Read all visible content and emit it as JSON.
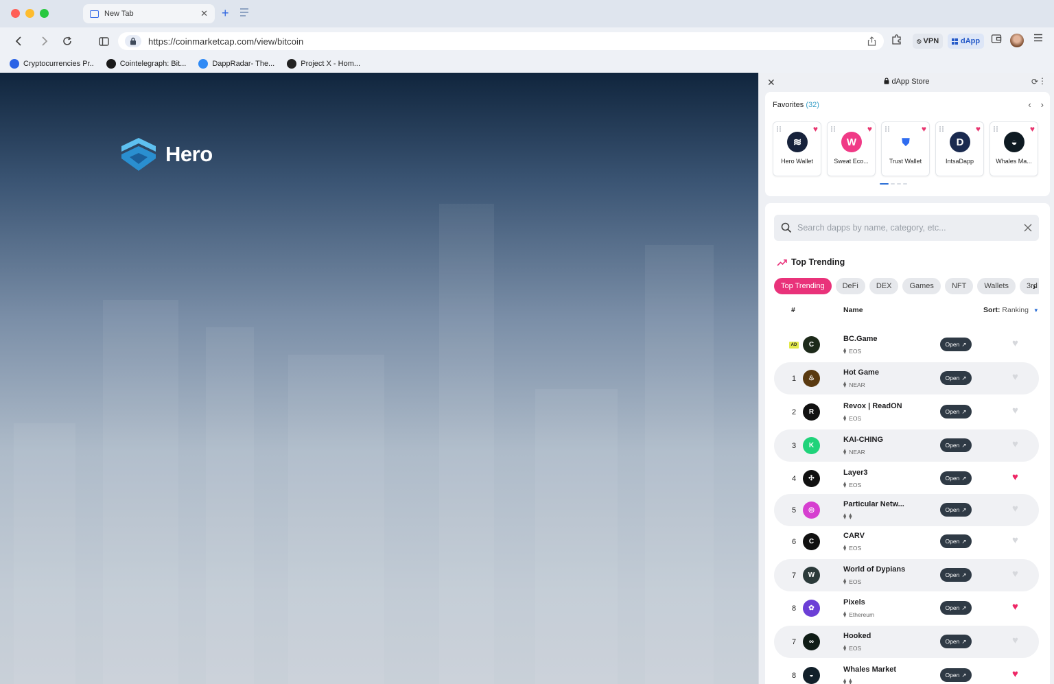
{
  "browser": {
    "tab_title": "New Tab",
    "url": "https://coinmarketcap.com/view/bitcoin",
    "vpn_label": "VPN",
    "dapp_label": "dApp",
    "bookmarks": [
      {
        "label": "Cryptocurrencies Pr..",
        "color": "#2b63e6"
      },
      {
        "label": "Cointelegraph: Bit...",
        "color": "#1a1a1a"
      },
      {
        "label": "DappRadar- The...",
        "color": "#2f8af5"
      },
      {
        "label": "Project X - Hom...",
        "color": "#222222"
      }
    ]
  },
  "hero": {
    "brand": "Hero"
  },
  "panel": {
    "title": "dApp Store",
    "favorites": {
      "label": "Favorites",
      "count": "(32)",
      "items": [
        {
          "name": "Hero Wallet",
          "bg": "#17223b",
          "glyph": "≋"
        },
        {
          "name": "Sweat Eco...",
          "bg": "#f03a86",
          "glyph": "W"
        },
        {
          "name": "Trust Wallet",
          "bg": "#ffffff",
          "glyph": "⛊"
        },
        {
          "name": "IntsaDapp",
          "bg": "#1a2a4f",
          "glyph": "D"
        },
        {
          "name": "Whales Ma...",
          "bg": "#0e1a22",
          "glyph": "◒"
        }
      ]
    },
    "search": {
      "placeholder": "Search dapps by name, category, etc..."
    },
    "trending_title": "Top Trending",
    "chips": [
      "Top Trending",
      "DeFi",
      "DEX",
      "Games",
      "NFT",
      "Wallets",
      "3rd"
    ],
    "table": {
      "col_rank": "#",
      "col_name": "Name",
      "sort_label": "Sort:",
      "sort_value": "Ranking",
      "open_label": "Open",
      "ad_label": "AD",
      "rows": [
        {
          "rank": "",
          "ad": true,
          "name": "BC.Game",
          "chain": "EOS",
          "icon_bg": "#1d2a1a",
          "icon": "C",
          "fav": false
        },
        {
          "rank": "1",
          "name": "Hot Game",
          "chain": "NEAR",
          "icon_bg": "#5a3a10",
          "icon": "♨",
          "fav": false
        },
        {
          "rank": "2",
          "name": "Revox | ReadON",
          "chain": "EOS",
          "icon_bg": "#111111",
          "icon": "R",
          "fav": false
        },
        {
          "rank": "3",
          "name": "KAI-CHING",
          "chain": "NEAR",
          "icon_bg": "#1fd37a",
          "icon": "K",
          "fav": false
        },
        {
          "rank": "4",
          "name": "Layer3",
          "chain": "EOS",
          "icon_bg": "#111111",
          "icon": "✣",
          "fav": true
        },
        {
          "rank": "5",
          "name": "Particular Netw...",
          "chain": "",
          "icon_bg": "#d63fd0",
          "icon": "◎",
          "fav": false
        },
        {
          "rank": "6",
          "name": "CARV",
          "chain": "EOS",
          "icon_bg": "#111111",
          "icon": "C",
          "fav": false
        },
        {
          "rank": "7",
          "name": "World of Dypians",
          "chain": "EOS",
          "icon_bg": "#2b3a3a",
          "icon": "W",
          "fav": false
        },
        {
          "rank": "8",
          "name": "Pixels",
          "chain": "Ethereum",
          "icon_bg": "#6c3fd6",
          "icon": "✿",
          "fav": true
        },
        {
          "rank": "7",
          "name": "Hooked",
          "chain": "EOS",
          "icon_bg": "#0f1c16",
          "icon": "∞",
          "fav": false
        },
        {
          "rank": "8",
          "name": "Whales Market",
          "chain": "",
          "icon_bg": "#12202a",
          "icon": "◒",
          "fav": true
        }
      ]
    }
  },
  "colors": {
    "accent_pink": "#e9327a",
    "heart_on": "#ee2766",
    "heart_off": "#d6d8dc"
  }
}
